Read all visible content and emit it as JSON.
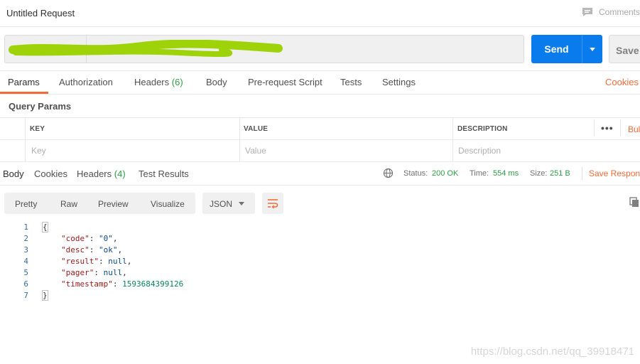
{
  "title": "Untitled Request",
  "comments_label": "Comments",
  "send_label": "Send",
  "save_label": "Save",
  "request_tabs": {
    "params": "Params",
    "authorization": "Authorization",
    "headers": "Headers",
    "headers_count": "(6)",
    "body": "Body",
    "prerequest": "Pre-request Script",
    "tests": "Tests",
    "settings": "Settings",
    "cookies": "Cookies"
  },
  "query_params": {
    "title": "Query Params",
    "columns": {
      "key": "KEY",
      "value": "VALUE",
      "description": "DESCRIPTION"
    },
    "placeholders": {
      "key": "Key",
      "value": "Value",
      "description": "Description"
    },
    "more": "•••",
    "bulk_edit": "Bulk Edit"
  },
  "response": {
    "tabs": {
      "body": "Body",
      "cookies": "Cookies",
      "headers": "Headers",
      "headers_count": "(4)",
      "test_results": "Test Results"
    },
    "status_label": "Status:",
    "status_value": "200 OK",
    "time_label": "Time:",
    "time_value": "554 ms",
    "size_label": "Size:",
    "size_value": "251 B",
    "save_response": "Save Response"
  },
  "view_tabs": {
    "pretty": "Pretty",
    "raw": "Raw",
    "preview": "Preview",
    "visualize": "Visualize"
  },
  "format": "JSON",
  "code": {
    "line_numbers": [
      "1",
      "2",
      "3",
      "4",
      "5",
      "6",
      "7"
    ],
    "open_brace": "{",
    "close_brace": "}",
    "fields": [
      {
        "key": "\"code\"",
        "value": "\"0\"",
        "trail": ","
      },
      {
        "key": "\"desc\"",
        "value": "\"ok\"",
        "trail": ","
      },
      {
        "key": "\"result\"",
        "value": "null",
        "trail": ","
      },
      {
        "key": "\"pager\"",
        "value": "null",
        "trail": ","
      },
      {
        "key": "\"timestamp\"",
        "value": "1593684399126",
        "trail": ""
      }
    ]
  },
  "watermark": "https://blog.csdn.net/qq_39918471",
  "colors": {
    "accent": "#f26b3a",
    "send": "#097bed",
    "success": "#2e9e43"
  },
  "icons": [
    "comment-icon",
    "chevron-down-icon",
    "globe-icon",
    "wrap-lines-icon",
    "copy-icon"
  ]
}
